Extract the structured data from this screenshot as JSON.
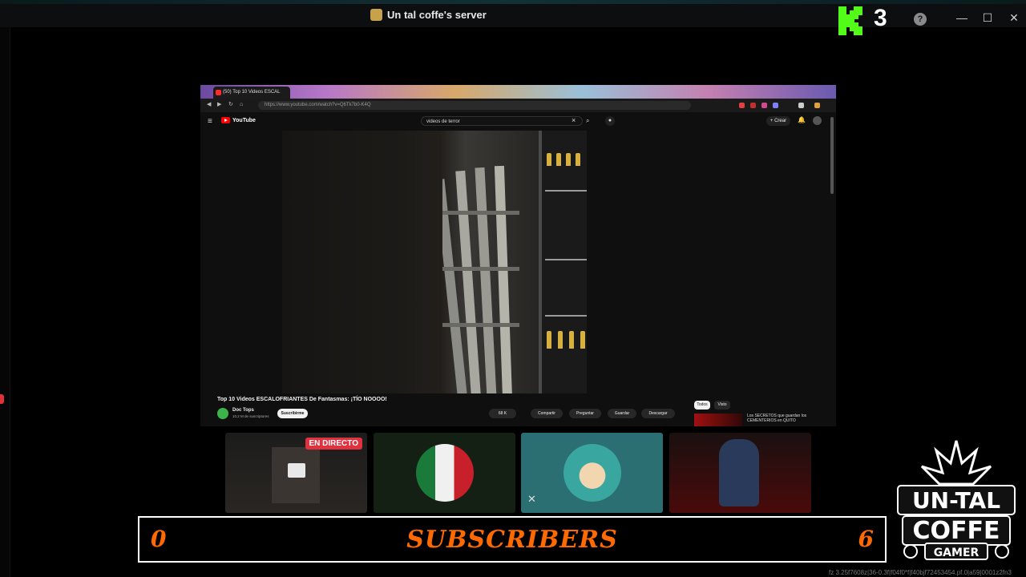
{
  "window": {
    "title": "Un tal coffe's server",
    "overlay_count": "3",
    "help": "?",
    "minimize": "—",
    "maximize": "☐",
    "close": "✕"
  },
  "browser": {
    "tab_title": "(50) Top 10 Videos ESCAL",
    "url": "https://www.youtube.com/watch?v=Q6Tk7b0-K4Q",
    "search_query": "videos de terror",
    "yt_brand": "YouTube",
    "create_label": "+ Crear",
    "video": {
      "title": "Top 10 Videos ESCALOFRIANTES De Fantasmas: ¡TÍO NOOOO!",
      "channel": "Doc Tops",
      "subscribers": "10,2 M de suscriptores",
      "subscribe_label": "Suscribirme",
      "likes": "68 K",
      "share": "Compartir",
      "ask": "Preguntar",
      "save": "Guardar",
      "download": "Descargar"
    },
    "chips": [
      "Todos",
      "Visto"
    ],
    "recommended_title": "Los SECRETOS que guardan los CEMENTERIOS en QUITO"
  },
  "participants": [
    {
      "name": "stream-tile",
      "badge": "EN DIRECTO"
    },
    {
      "name": "flag-avatar-tile"
    },
    {
      "name": "anime-avatar-tile",
      "muted": true
    },
    {
      "name": "camera-tile"
    }
  ],
  "ticker": {
    "left": "0",
    "center": "SUBSCRIBERS",
    "right": "6"
  },
  "brand": {
    "line1": "UN-TAL",
    "line2": "COFFE",
    "line3": "GAMER"
  },
  "footer": "fz 3.25f7608z|36-0.3f|f04f0*f|f40bjf72453454.pf.0|a59|0001z2fn3"
}
